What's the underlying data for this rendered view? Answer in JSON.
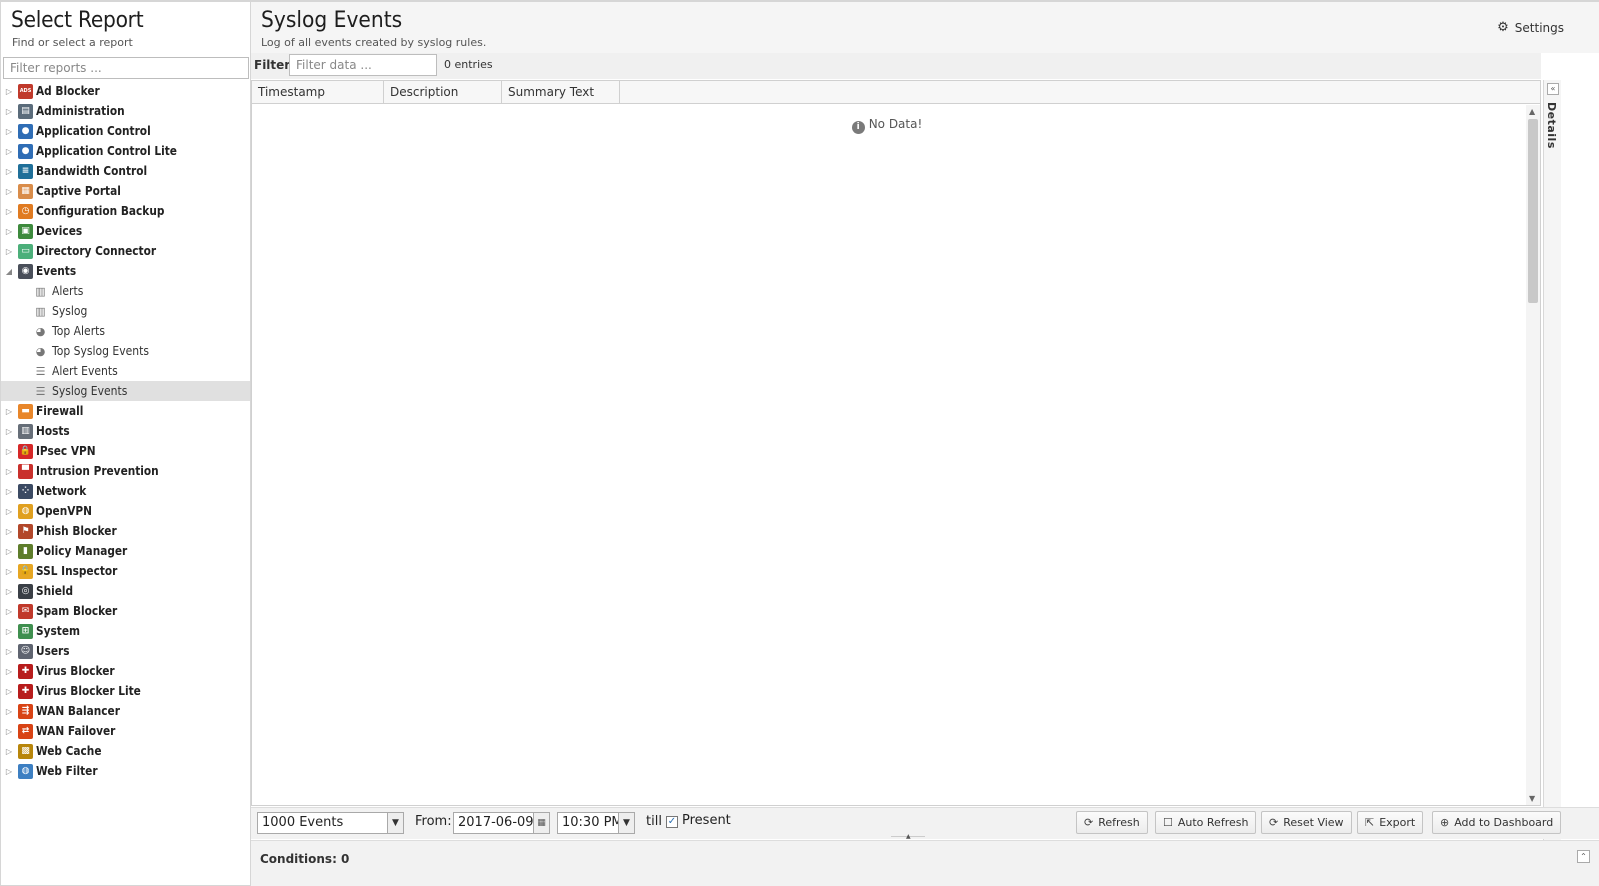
{
  "sidebar": {
    "title": "Select Report",
    "subtitle": "Find or select a report",
    "filter_placeholder": "Filter reports ...",
    "apps": [
      {
        "label": "Ad Blocker",
        "icon": "ad-blocker-icon",
        "color": "#c0392b",
        "glyph": "ADS"
      },
      {
        "label": "Administration",
        "icon": "administration-icon",
        "color": "#5a6b7a",
        "glyph": "▤"
      },
      {
        "label": "Application Control",
        "icon": "application-control-icon",
        "color": "#2f6db5",
        "glyph": "●"
      },
      {
        "label": "Application Control Lite",
        "icon": "application-control-lite-icon",
        "color": "#2f6db5",
        "glyph": "●"
      },
      {
        "label": "Bandwidth Control",
        "icon": "bandwidth-control-icon",
        "color": "#1f6f99",
        "glyph": "≡"
      },
      {
        "label": "Captive Portal",
        "icon": "captive-portal-icon",
        "color": "#d98c4a",
        "glyph": "▦"
      },
      {
        "label": "Configuration Backup",
        "icon": "configuration-backup-icon",
        "color": "#e07b22",
        "glyph": "◷"
      },
      {
        "label": "Devices",
        "icon": "devices-icon",
        "color": "#3d8a3d",
        "glyph": "▣"
      },
      {
        "label": "Directory Connector",
        "icon": "directory-connector-icon",
        "color": "#4caf7a",
        "glyph": "▭"
      },
      {
        "label": "Events",
        "icon": "events-icon",
        "color": "#4a4f5a",
        "glyph": "◉",
        "expanded": true,
        "children": [
          {
            "label": "Alerts",
            "icon": "bar-chart-icon",
            "glyph": "📊"
          },
          {
            "label": "Syslog",
            "icon": "bar-chart-icon",
            "glyph": "📊"
          },
          {
            "label": "Top Alerts",
            "icon": "pie-chart-icon",
            "glyph": "◕"
          },
          {
            "label": "Top Syslog Events",
            "icon": "pie-chart-icon",
            "glyph": "◕"
          },
          {
            "label": "Alert Events",
            "icon": "list-icon",
            "glyph": "☰"
          },
          {
            "label": "Syslog Events",
            "icon": "list-icon",
            "glyph": "☰",
            "selected": true
          }
        ]
      },
      {
        "label": "Firewall",
        "icon": "firewall-icon",
        "color": "#e8862a",
        "glyph": "▬"
      },
      {
        "label": "Hosts",
        "icon": "hosts-icon",
        "color": "#666e78",
        "glyph": "▥"
      },
      {
        "label": "IPsec VPN",
        "icon": "ipsec-vpn-icon",
        "color": "#d62828",
        "glyph": "🔒"
      },
      {
        "label": "Intrusion Prevention",
        "icon": "intrusion-prevention-icon",
        "color": "#c9302c",
        "glyph": "▀"
      },
      {
        "label": "Network",
        "icon": "network-icon",
        "color": "#3b4a63",
        "glyph": "⁘"
      },
      {
        "label": "OpenVPN",
        "icon": "openvpn-icon",
        "color": "#e0a020",
        "glyph": "◍"
      },
      {
        "label": "Phish Blocker",
        "icon": "phish-blocker-icon",
        "color": "#b2472a",
        "glyph": "⚑"
      },
      {
        "label": "Policy Manager",
        "icon": "policy-manager-icon",
        "color": "#5e7d2b",
        "glyph": "▮"
      },
      {
        "label": "SSL Inspector",
        "icon": "ssl-inspector-icon",
        "color": "#e6a623",
        "glyph": "🔒"
      },
      {
        "label": "Shield",
        "icon": "shield-icon",
        "color": "#3a3f46",
        "glyph": "◎"
      },
      {
        "label": "Spam Blocker",
        "icon": "spam-blocker-icon",
        "color": "#c0392b",
        "glyph": "✉"
      },
      {
        "label": "System",
        "icon": "system-icon",
        "color": "#3f8f4f",
        "glyph": "⊞"
      },
      {
        "label": "Users",
        "icon": "users-icon",
        "color": "#5f6470",
        "glyph": "☺"
      },
      {
        "label": "Virus Blocker",
        "icon": "virus-blocker-icon",
        "color": "#b71c1c",
        "glyph": "✚"
      },
      {
        "label": "Virus Blocker Lite",
        "icon": "virus-blocker-lite-icon",
        "color": "#b71c1c",
        "glyph": "✚"
      },
      {
        "label": "WAN Balancer",
        "icon": "wan-balancer-icon",
        "color": "#d84315",
        "glyph": "⇶"
      },
      {
        "label": "WAN Failover",
        "icon": "wan-failover-icon",
        "color": "#d84315",
        "glyph": "⇄"
      },
      {
        "label": "Web Cache",
        "icon": "web-cache-icon",
        "color": "#b8860b",
        "glyph": "▩"
      },
      {
        "label": "Web Filter",
        "icon": "web-filter-icon",
        "color": "#3d7fc2",
        "glyph": "◍"
      }
    ]
  },
  "header": {
    "title": "Syslog Events",
    "subtitle": "Log of all events created by syslog rules.",
    "settings_label": "Settings"
  },
  "filterbar": {
    "label": "Filter:",
    "placeholder": "Filter data ...",
    "entries_text": "0 entries"
  },
  "grid": {
    "columns": [
      {
        "label": "Timestamp",
        "width": 132
      },
      {
        "label": "Description",
        "width": 118
      },
      {
        "label": "Summary Text",
        "width": 118
      }
    ],
    "empty_text": "No Data!"
  },
  "details": {
    "label": "Details"
  },
  "toolbar": {
    "events_limit": "1000 Events",
    "from_label": "From:",
    "from_date": "2017-06-09",
    "from_time": "10:30 PM",
    "till_label": "till",
    "present_checked": true,
    "present_label": "Present",
    "buttons": {
      "refresh": "Refresh",
      "auto_refresh": "Auto Refresh",
      "reset_view": "Reset View",
      "export": "Export",
      "add_to_dashboard": "Add to Dashboard"
    }
  },
  "conditions": {
    "label": "Conditions: 0"
  }
}
